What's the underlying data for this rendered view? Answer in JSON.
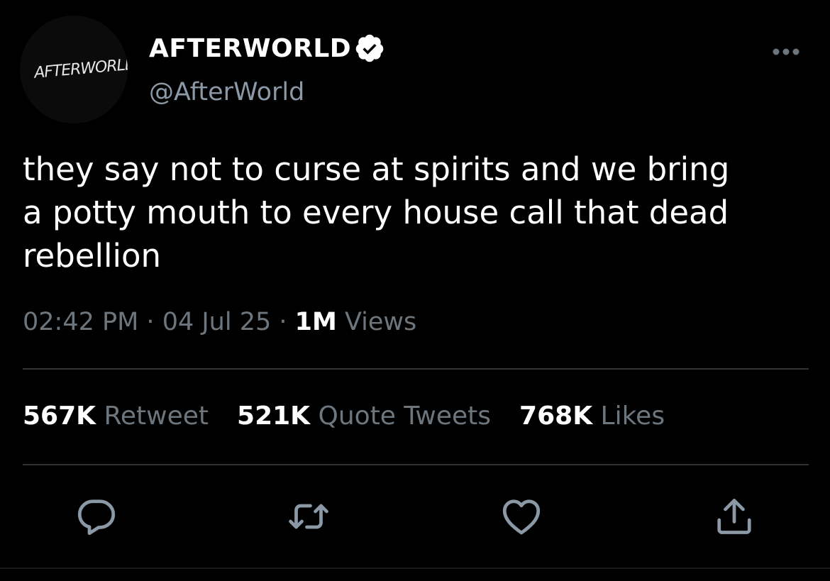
{
  "tweet": {
    "avatar_logo_text": "AFTERWORLD",
    "display_name": "AFTERWORLD",
    "handle": "@AfterWorld",
    "text": "they say not to curse at spirits and we bring\na potty mouth to every house call that dead\nrebellion",
    "time": "02:42 PM",
    "separator": " · ",
    "date": "04 Jul 25",
    "views_count": "1M",
    "views_label": "Views"
  },
  "stats": {
    "retweets_count": "567K",
    "retweets_label": "Retweet",
    "quotes_count": "521K",
    "quotes_label": "Quote Tweets",
    "likes_count": "768K",
    "likes_label": "Likes"
  },
  "icons": {
    "verified": "verified-badge-icon",
    "more": "more-dots-icon",
    "reply": "reply-icon",
    "retweet": "retweet-icon",
    "like": "heart-icon",
    "share": "share-icon"
  },
  "colors": {
    "background": "#000000",
    "text_primary": "#ffffff",
    "text_secondary": "#8b98a5",
    "text_muted": "#6e767d",
    "divider": "#2f3336"
  }
}
